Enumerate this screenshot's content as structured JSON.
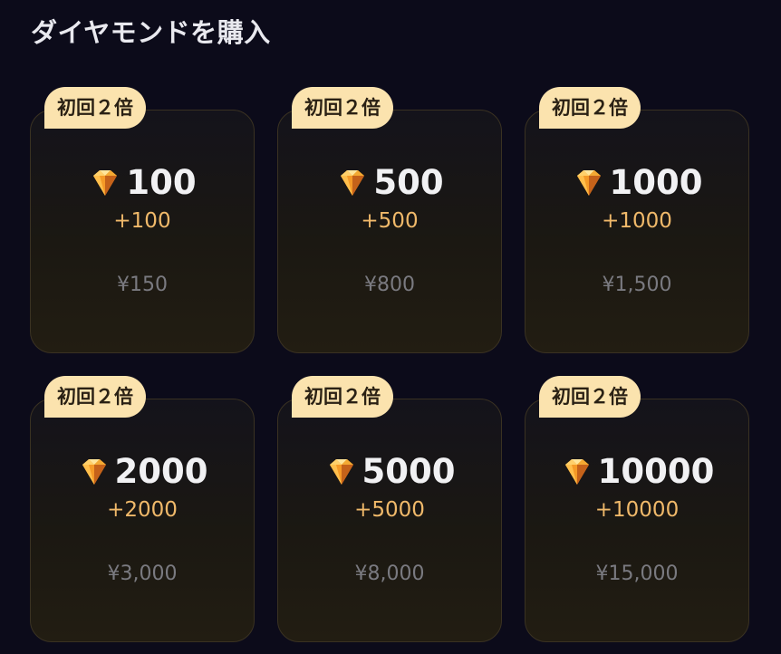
{
  "header": {
    "title": "ダイヤモンドを購入"
  },
  "icons": {
    "gem": "diamond-icon"
  },
  "colors": {
    "background": "#0c0b1a",
    "badge": "#fbe3ae",
    "bonus": "#f0b96a",
    "price": "#7a7a80"
  },
  "packages": [
    {
      "badge": "初回２倍",
      "amount": "100",
      "bonus": "+100",
      "price": "¥150"
    },
    {
      "badge": "初回２倍",
      "amount": "500",
      "bonus": "+500",
      "price": "¥800"
    },
    {
      "badge": "初回２倍",
      "amount": "1000",
      "bonus": "+1000",
      "price": "¥1,500"
    },
    {
      "badge": "初回２倍",
      "amount": "2000",
      "bonus": "+2000",
      "price": "¥3,000"
    },
    {
      "badge": "初回２倍",
      "amount": "5000",
      "bonus": "+5000",
      "price": "¥8,000"
    },
    {
      "badge": "初回２倍",
      "amount": "10000",
      "bonus": "+10000",
      "price": "¥15,000"
    }
  ]
}
